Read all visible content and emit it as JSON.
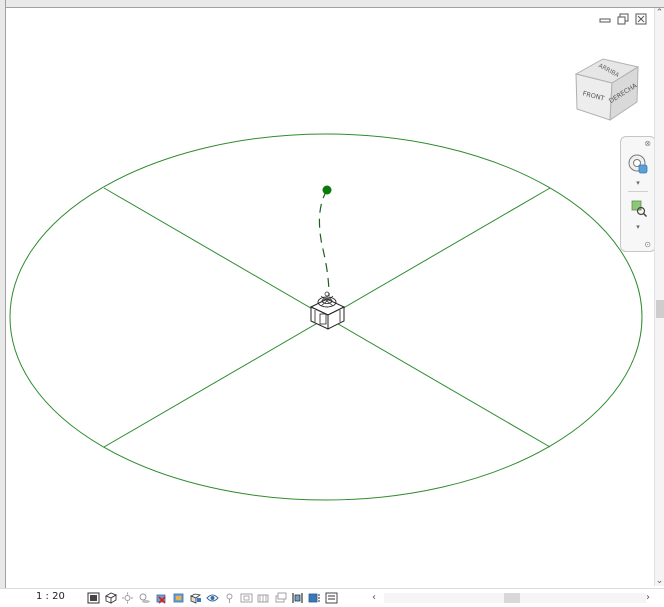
{
  "viewcube": {
    "face_front": "FRONT",
    "face_right": "DERECHA",
    "face_top": "ARRIBA"
  },
  "status_bar": {
    "scale": "1 : 20"
  },
  "colors": {
    "drawing_green": "#2e8b2e",
    "point_green": "#0a7a0a",
    "background": "#ffffff"
  },
  "icons": {
    "window": [
      "minimize-icon",
      "restore-icon",
      "close-icon"
    ],
    "navigation": [
      "steering-wheel-icon",
      "zoom-region-icon"
    ],
    "view_control": [
      "detail-level-icon",
      "visual-style-icon",
      "sun-path-icon",
      "shadows-icon",
      "crop-view-icon",
      "show-crop-icon",
      "unlock-3d-icon",
      "temporary-hide-icon",
      "reveal-hidden-icon",
      "temporary-view-properties-icon",
      "analysis-display-icon",
      "highlight-displacement-icon",
      "constraints-icon",
      "worksharing-icon",
      "view-properties-icon"
    ]
  }
}
